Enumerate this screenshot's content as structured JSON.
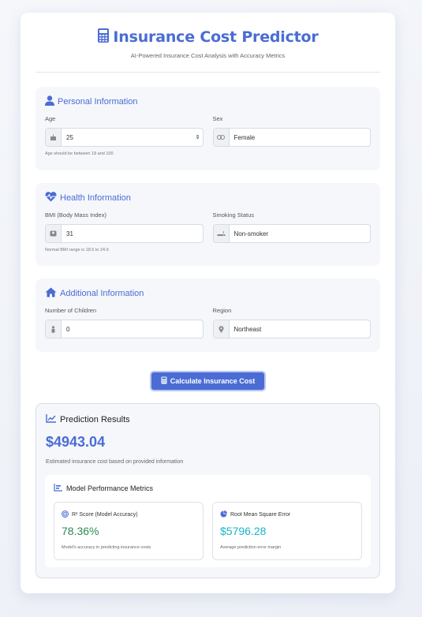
{
  "header": {
    "title": "Insurance Cost Predictor",
    "subtitle": "AI-Powered Insurance Cost Analysis with Accuracy Metrics"
  },
  "personal": {
    "title": "Personal Information",
    "age_label": "Age",
    "age_value": "25",
    "age_help": "Age should be between 18 and 100",
    "sex_label": "Sex",
    "sex_value": "Female"
  },
  "health": {
    "title": "Health Information",
    "bmi_label": "BMI (Body Mass Index)",
    "bmi_value": "31",
    "bmi_help": "Normal BMI range is 18.5 to 24.9",
    "smoking_label": "Smoking Status",
    "smoking_value": "Non-smoker"
  },
  "additional": {
    "title": "Additional Information",
    "children_label": "Number of Children",
    "children_value": "0",
    "region_label": "Region",
    "region_value": "Northeast"
  },
  "action": {
    "calculate_label": "Calculate Insurance Cost"
  },
  "results": {
    "title": "Prediction Results",
    "amount": "$4943.04",
    "note": "Estimated insurance cost based on provided information",
    "metrics_title": "Model Performance Metrics",
    "r2": {
      "label": "R² Score (Model Accuracy)",
      "value": "78.36%",
      "desc": "Model's accuracy in predicting insurance costs"
    },
    "rmse": {
      "label": "Root Mean Square Error",
      "value": "$5796.28",
      "desc": "Average prediction error margin"
    }
  },
  "colors": {
    "accent": "#4a6cd4",
    "r2_value": "#2b8a54",
    "rmse_value": "#1ab5c8"
  }
}
